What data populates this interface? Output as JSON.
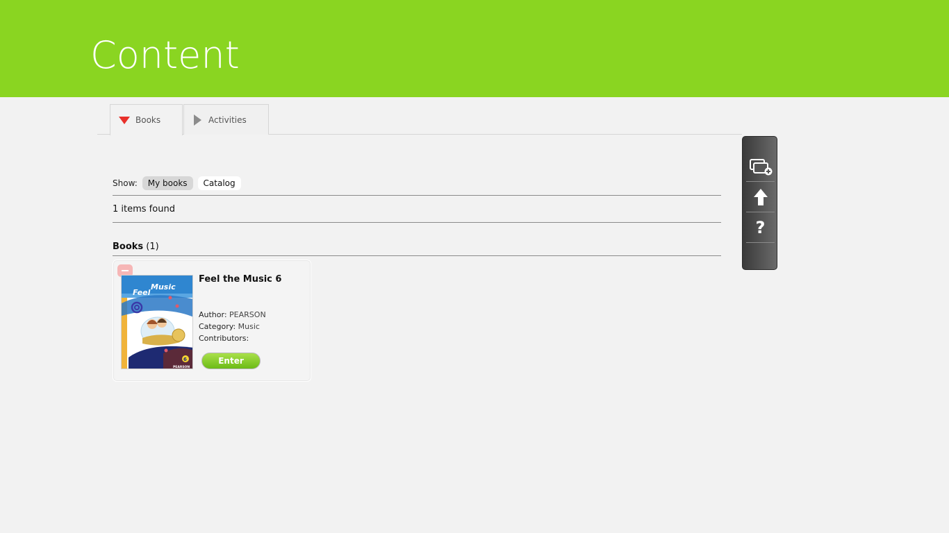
{
  "header": {
    "title": "Content"
  },
  "tabs": [
    {
      "label": "Books",
      "active": true
    },
    {
      "label": "Activities",
      "active": false
    }
  ],
  "filter": {
    "show_label": "Show:",
    "options": [
      {
        "label": "My books",
        "selected": true
      },
      {
        "label": "Catalog",
        "selected": false
      }
    ]
  },
  "results": {
    "found_text": "1 items found"
  },
  "section": {
    "title": "Books",
    "count": "(1)"
  },
  "book": {
    "title": "Feel the Music 6",
    "author_label": "Author:",
    "author": "PEARSON",
    "category_label": "Category:",
    "category": "Music",
    "contributors_label": "Contributors:",
    "contributors": "",
    "enter_label": "Enter",
    "cover": {
      "series_text": "Feel the Music",
      "publisher_text": "PEARSON",
      "grade": "6"
    }
  },
  "toolbar": {
    "icons": [
      "add-windows-icon",
      "upload-arrow-icon",
      "help-icon"
    ],
    "help_glyph": "?"
  },
  "colors": {
    "header_bg": "#8ad521",
    "active_tab_marker": "#e8302a",
    "enter_button": "#7cc61f",
    "remove_button": "#f6b6b6"
  }
}
